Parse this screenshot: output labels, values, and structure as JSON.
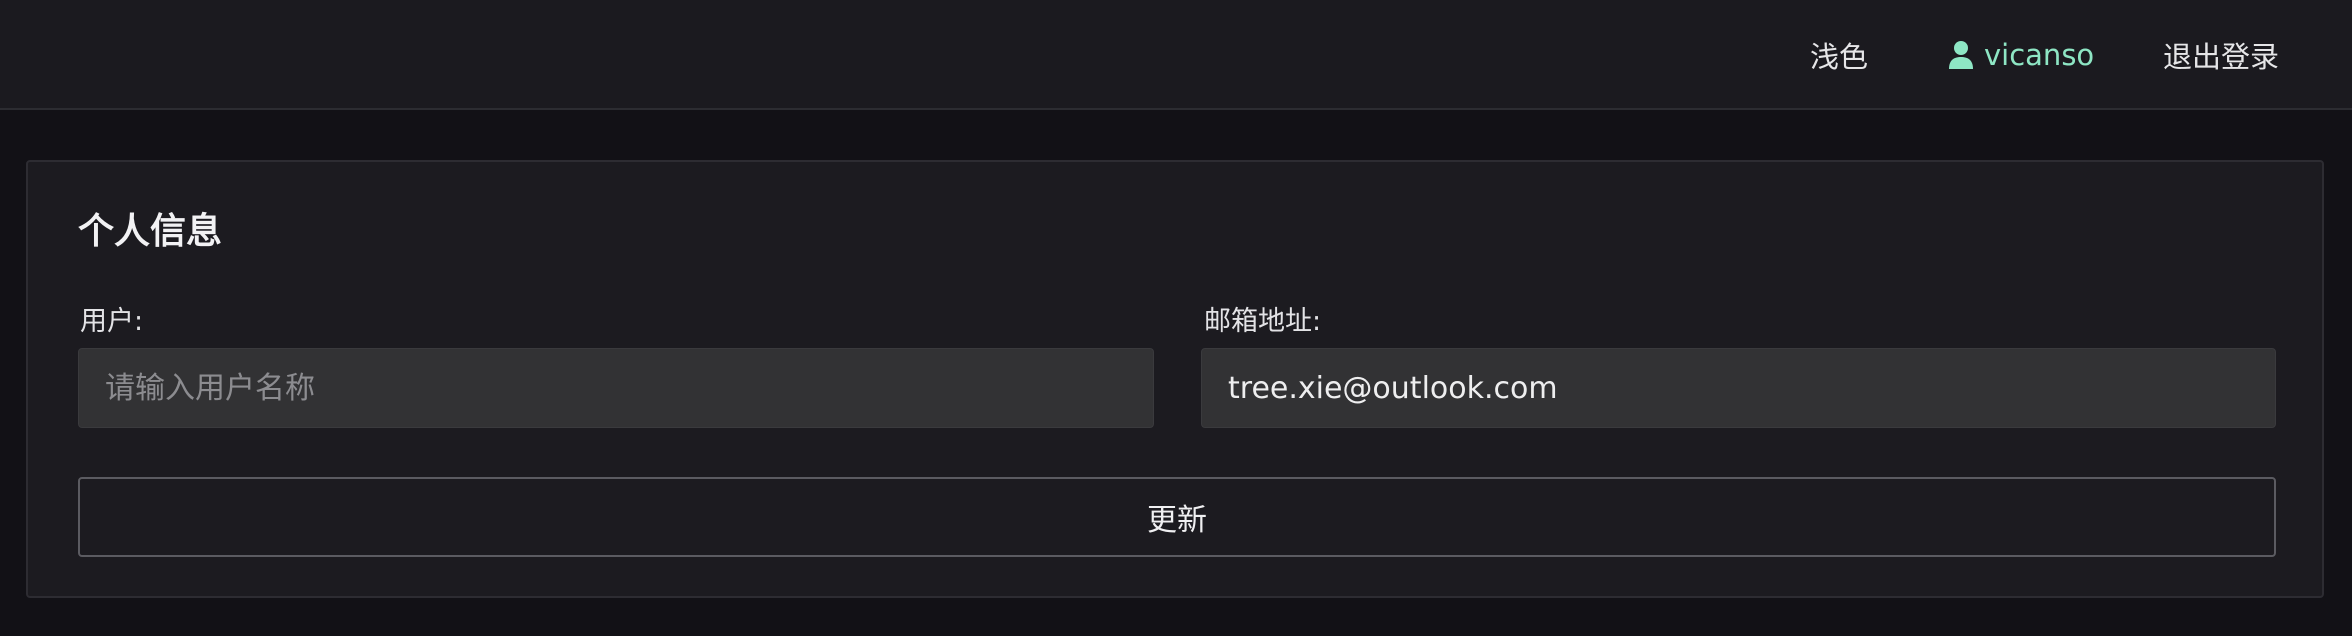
{
  "header": {
    "theme_toggle_label": "浅色",
    "username": "vicanso",
    "logout_label": "退出登录",
    "user_color": "#8ee6c4"
  },
  "profile": {
    "title": "个人信息",
    "user_field": {
      "label": "用户:",
      "value": "",
      "placeholder": "请输入用户名称"
    },
    "email_field": {
      "label": "邮箱地址:",
      "value": "tree.xie@outlook.com"
    },
    "update_label": "更新"
  }
}
